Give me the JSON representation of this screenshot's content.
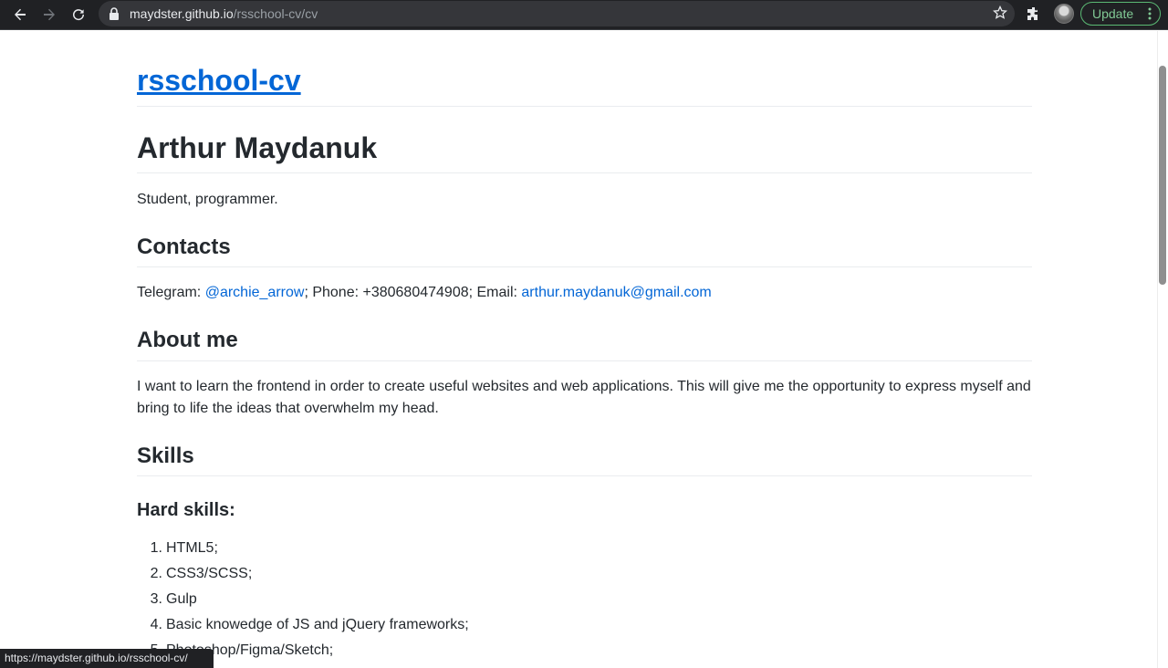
{
  "browser": {
    "url_host": "maydster.github.io",
    "url_path": "/rsschool-cv/cv",
    "update_label": "Update",
    "status_url": "https://maydster.github.io/rsschool-cv/"
  },
  "page": {
    "site_title": "rsschool-cv",
    "name": "Arthur Maydanuk",
    "tagline": "Student, programmer.",
    "contacts": {
      "heading": "Contacts",
      "telegram_label": "Telegram: ",
      "telegram_handle": "@archie_arrow",
      "phone_text": "; Phone: +380680474908; Email: ",
      "email": "arthur.maydanuk@gmail.com"
    },
    "about": {
      "heading": "About me",
      "text": "I want to learn the frontend in order to create useful websites and web applications. This will give me the opportunity to express myself and bring to life the ideas that overwhelm my head."
    },
    "skills": {
      "heading": "Skills",
      "hard_heading": "Hard skills:",
      "hard_items": [
        {
          "num": "1.",
          "text": "HTML5;"
        },
        {
          "num": "2.",
          "text": "CSS3/SCSS;"
        },
        {
          "num": "3.",
          "text": "Gulp"
        },
        {
          "num": "4.",
          "text": "Basic knowedge of JS and jQuery frameworks;"
        },
        {
          "num": "5.",
          "text": "Photoshop/Figma/Sketch;"
        }
      ]
    }
  },
  "colors": {
    "link": "#0366d6",
    "text": "#24292e",
    "chrome_bg": "#202124",
    "update_green": "#81c995"
  }
}
